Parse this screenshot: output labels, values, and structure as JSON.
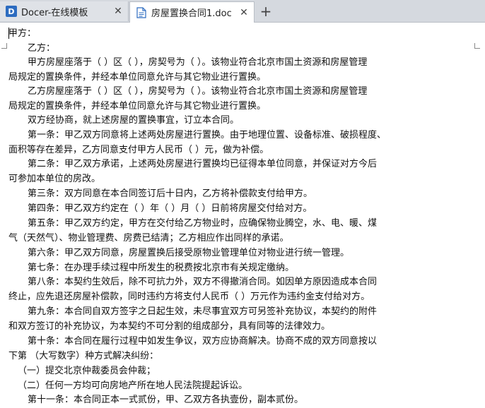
{
  "tabs": [
    {
      "label": "Docer-在线模板",
      "icon": "docer-icon",
      "active": false
    },
    {
      "label": "房屋置换合同1.doc",
      "icon": "doc-icon",
      "active": true
    }
  ],
  "new_tab_symbol": "+",
  "close_symbol": "✕",
  "document": {
    "lines": [
      "甲方：",
      "乙方：",
      "甲方房屋座落于（ ）区（ ），房契号为（ ）。该物业符合北京市国土资源和房屋管理",
      "局规定的置换条件，并经本单位同意允许与其它物业进行置换。",
      "乙方房屋座落于（ ）区（ ），房契号为（ ）。该物业符合北京市国土资源和房屋管理",
      "局规定的置换条件，并经本单位同意允许与其它物业进行置换。",
      "双方经协商，就上述房屋的置换事宜，订立本合同。",
      "第一条：甲乙双方同意将上述两处房屋进行置换。由于地理位置、设备标准、破损程度、",
      "面积等存在差异，乙方同意支付甲方人民币（ ）元，做为补偿。",
      "第二条：甲乙双方承诺，上述两处房屋进行置换均已征得本单位同意，并保证对方今后",
      "可参加本单位的房改。",
      "第三条：双方同意在本合同签订后十日内，乙方将补偿款支付给甲方。",
      "第四条：甲乙双方约定在（ ）年（ ）月（ ）日前将房屋交付给对方。",
      "第五条：甲乙双方约定，甲方在交付给乙方物业时，应确保物业腾空，水、电、暖、煤",
      "气（天然气）、物业管理费、房费已结清；乙方相应作出同样的承诺。",
      "第六条：甲乙双方同意，房屋置换后接受原物业管理单位对物业进行统一管理。",
      "第七条：在办理手续过程中所发生的税费按北京市有关规定缴纳。",
      "第八条：本契约生效后，除不可抗力外，双方不得撤消合同。如因单方原因造成本合同",
      "终止，应先退还房屋补偿款，同时违约方将支付人民币（ ）万元作为违约金支付给对方。",
      "第九条：本合同自双方签字之日起生效，未尽事宜双方可另签补充协议，本契约的附件",
      "和双方签订的补充协议，为本契约不可分割的组成部分，具有同等的法律效力。",
      "第十条：本合同在履行过程中如发生争议，双方应协商解决。协商不成的双方同意按以",
      "下第 （大写数字）种方式解决纠纷：",
      "（一）提交北京仲裁委员会仲裁；",
      "（二）任何一方均可向房地产所在地人民法院提起诉讼。",
      "第十一条：本合同正本一式贰份，甲、乙双方各执壹份，副本贰份。"
    ]
  }
}
